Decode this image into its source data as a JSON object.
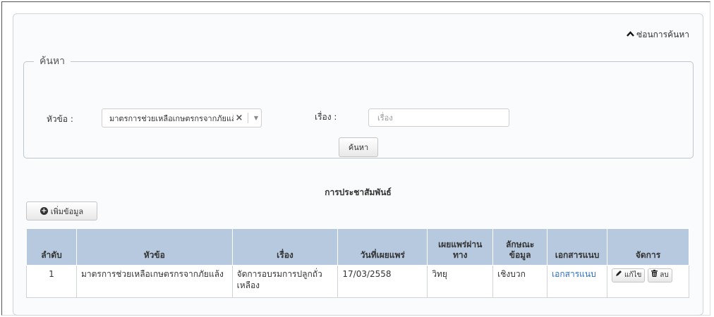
{
  "toggle_search": {
    "label": "ซ่อนการค้นหา",
    "icon": "chevron-up-icon"
  },
  "search": {
    "legend": "ค้นหา",
    "topic_label": "หัวข้อ :",
    "topic_value": "มาตรการช่วยเหลือเกษตรกรจากภัยแล้ง",
    "subject_label": "เรื่อง :",
    "subject_placeholder": "เรื่อง",
    "submit_label": "ค้นหา"
  },
  "table": {
    "title": "การประชาสัมพันธ์",
    "add_label": "เพิ่มข้อมูล",
    "headers": [
      "ลำดับ",
      "หัวข้อ",
      "เรื่อง",
      "วันที่เผยแพร่",
      "เผยแพร่ผ่านทาง",
      "ลักษณะข้อมูล",
      "เอกสารแนบ",
      "จัดการ"
    ],
    "rows": [
      {
        "no": "1",
        "topic": "มาตรการช่วยเหลือเกษตรกรจากภัยแล้ง",
        "subject": "จัดการอบรมการปลูกถั่วเหลือง",
        "date": "17/03/2558",
        "channel": "วิทยุ",
        "type": "เชิงบวก",
        "attachment": "เอกสารแนบ",
        "edit_label": "แก้ไข",
        "delete_label": "ลบ"
      }
    ]
  }
}
